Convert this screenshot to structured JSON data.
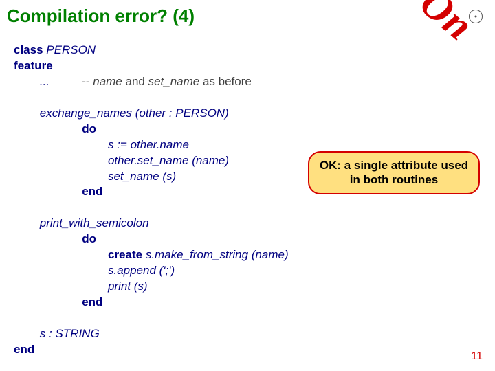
{
  "title": "Compilation error? (4)",
  "stamp": "Hands-On",
  "callout": "OK: a single attribute used in both routines",
  "page_number": "11",
  "code": {
    "l1a": "class",
    "l1b": " PERSON",
    "l2": "feature",
    "l3a": "        ...          ",
    "l3b": "-- ",
    "l3c": "name",
    "l3d": " and ",
    "l3e": "set_name",
    "l3f": " as before",
    "blank": " ",
    "l4a": "        exchange_names (other : PERSON)",
    "l5a": "                     ",
    "l5b": "do",
    "l6": "                             s := other.name",
    "l7": "                             other.set_name (name)",
    "l8": "                             set_name (s)",
    "l9a": "                     ",
    "l9b": "end",
    "l10": "        print_with_semicolon",
    "l11a": "                     ",
    "l11b": "do",
    "l12a": "                             ",
    "l12b": "create",
    "l12c": " s.make_from_string (name)",
    "l13": "                             s.append (';')",
    "l14": "                             print (s)",
    "l15a": "                     ",
    "l15b": "end",
    "l16": "        s : STRING",
    "l17": "end"
  }
}
